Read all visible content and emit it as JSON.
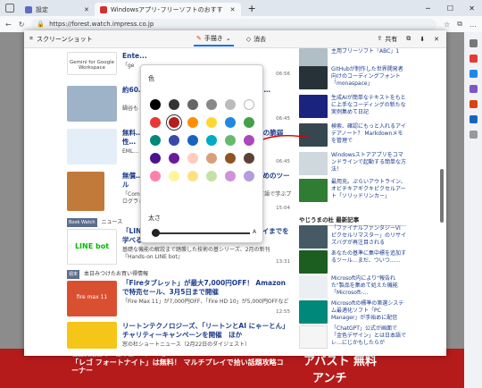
{
  "browser": {
    "tabs": [
      {
        "label": "設定",
        "color": "#5c6bc0"
      },
      {
        "label": "Windowsアプリ･フリーソフトのおすす",
        "color": "#d32f2f"
      }
    ],
    "url": "https://forest.watch.impress.co.jp"
  },
  "capture": {
    "title": "スクリーンショット",
    "draw_label": "手描き",
    "erase_label": "消去",
    "share_label": "共有"
  },
  "picker": {
    "color_label": "色",
    "size_label": "太さ",
    "size_small": "A",
    "colors": [
      "#000000",
      "#333333",
      "#666666",
      "#888888",
      "#bbbbbb",
      "#ffffff",
      "#e53935",
      "#b71c1c",
      "#ff8f00",
      "#fdd835",
      "#1e88e5",
      "#43a047",
      "#00897b",
      "#3949ab",
      "#1565c0",
      "#00acc1",
      "#66bb6a",
      "#ab47bc",
      "#4a148c",
      "#6a1b9a",
      "#ffccbc",
      "#d7a07a",
      "#8d5524",
      "#5d4037",
      "#ff80ab",
      "#fff59d",
      "#ffe082",
      "#c5e1a5",
      "#ce93d8",
      "#b39ddb"
    ],
    "selected_index": 7
  },
  "main": {
    "articles": [
      {
        "title": "Ente...",
        "desc": "「ge",
        "time": "06:56"
      },
      {
        "title": "約60…3円の電子書籍 子書籍端末として「iPa…",
        "desc": "鍋谷も",
        "time": "06:45"
      },
      {
        "title": "無料…ソフト「ThunderbirdⅠ」が公開…8件の脆弱性…",
        "desc": "EML…",
        "time": "06:45"
      },
      {
        "title": "無償…でプログラミングスキルを身につけるためのツール",
        "desc": "「ComI」を通して関数型プログラミングを学ぶ『関数型言語で学ぶプログラミングの基本』",
        "time": "15:04"
      },
      {
        "tag": "Book Watch",
        "tag2": "ニュース",
        "title": "「LINE」のボット開発はしめの一歩！ デプロイまでを学べる解説書が発売",
        "desc": "基礎な機能の解説まで踏襲した技術の基シリーズ、2月の新刊『Hands-on LINE bot』",
        "time": "13:31"
      },
      {
        "tag": "週末",
        "tag2": "本日みつけたお買い得情報",
        "title": "「Fireタブレット」が最大7,000円OFF！ Amazonで特売セール、3月5日まで開催",
        "desc": "「Fire Max 11」が7,000円OFF、「Fire HD 10」が5,000円OFFなど",
        "time": "12:55"
      },
      {
        "title": "リートンテクノロジーズ、「リートンとAI にゃーとん」チャリティーキャンペーンを開催　ほか",
        "desc": "窓の杜ショートニュース（2月22日のダイジェスト）",
        "time": ""
      }
    ],
    "thumb_labels": [
      "Gemini for Google Workspace",
      "",
      "",
      "",
      "LINE bot",
      "fire max 11",
      ""
    ]
  },
  "right": {
    "items": [
      {
        "text": "主用ブリーソフト「ABC」1"
      },
      {
        "text": "GitHubが制作した世界開発者向けのコーディングフォント「monaspace」"
      },
      {
        "text": "生成AIが簡単なテキストをもとに上手なコーディングの新たな実例集めて日記"
      },
      {
        "text": "検索、確認にもっと入れるアイデアノート？ Markdownメモを管理で"
      },
      {
        "text": "Windowsストアアプリをコマンドラインで起動する簡単な方法！"
      },
      {
        "text": "最用充。ぷらいアウトライン、オビチキアギクキピクセルアート「ソリッドリンカー」"
      }
    ],
    "section_title": "やじうまの杜  最新記事",
    "items2": [
      {
        "text": "「ファイナルファンタジーVI ピクセルリマスター」のリサイズバグが再注目される"
      },
      {
        "text": "あなたの基準に集中標を追加するツール…まだ、ついつ……"
      },
      {
        "text": "Microsoft内により\"報告れた\"製品を集めて処えた機能「Microsoft-…"
      },
      {
        "text": "Microsoftの標準の第選システム最適化ソフト「PC Manager」が手始めに配信"
      },
      {
        "text": "「ChatGPT」公式が画面で「金色デザイン」とは日本語でレ…にじかもしたらが"
      },
      {
        "text": "OpenAIがセル・アルトマンが「GPT-5」に言及！ーーだが「それはより難しな…"
      }
    ]
  },
  "bottom": {
    "line1": "石田翼紙書の「憧の桜 PCゲーム」",
    "line2": "「レゴ フォートナイト」は無料！ マルチプレイで拾い話題攻略コーナー",
    "ad1": "アバスト 無料",
    "ad2": "アンチ"
  }
}
